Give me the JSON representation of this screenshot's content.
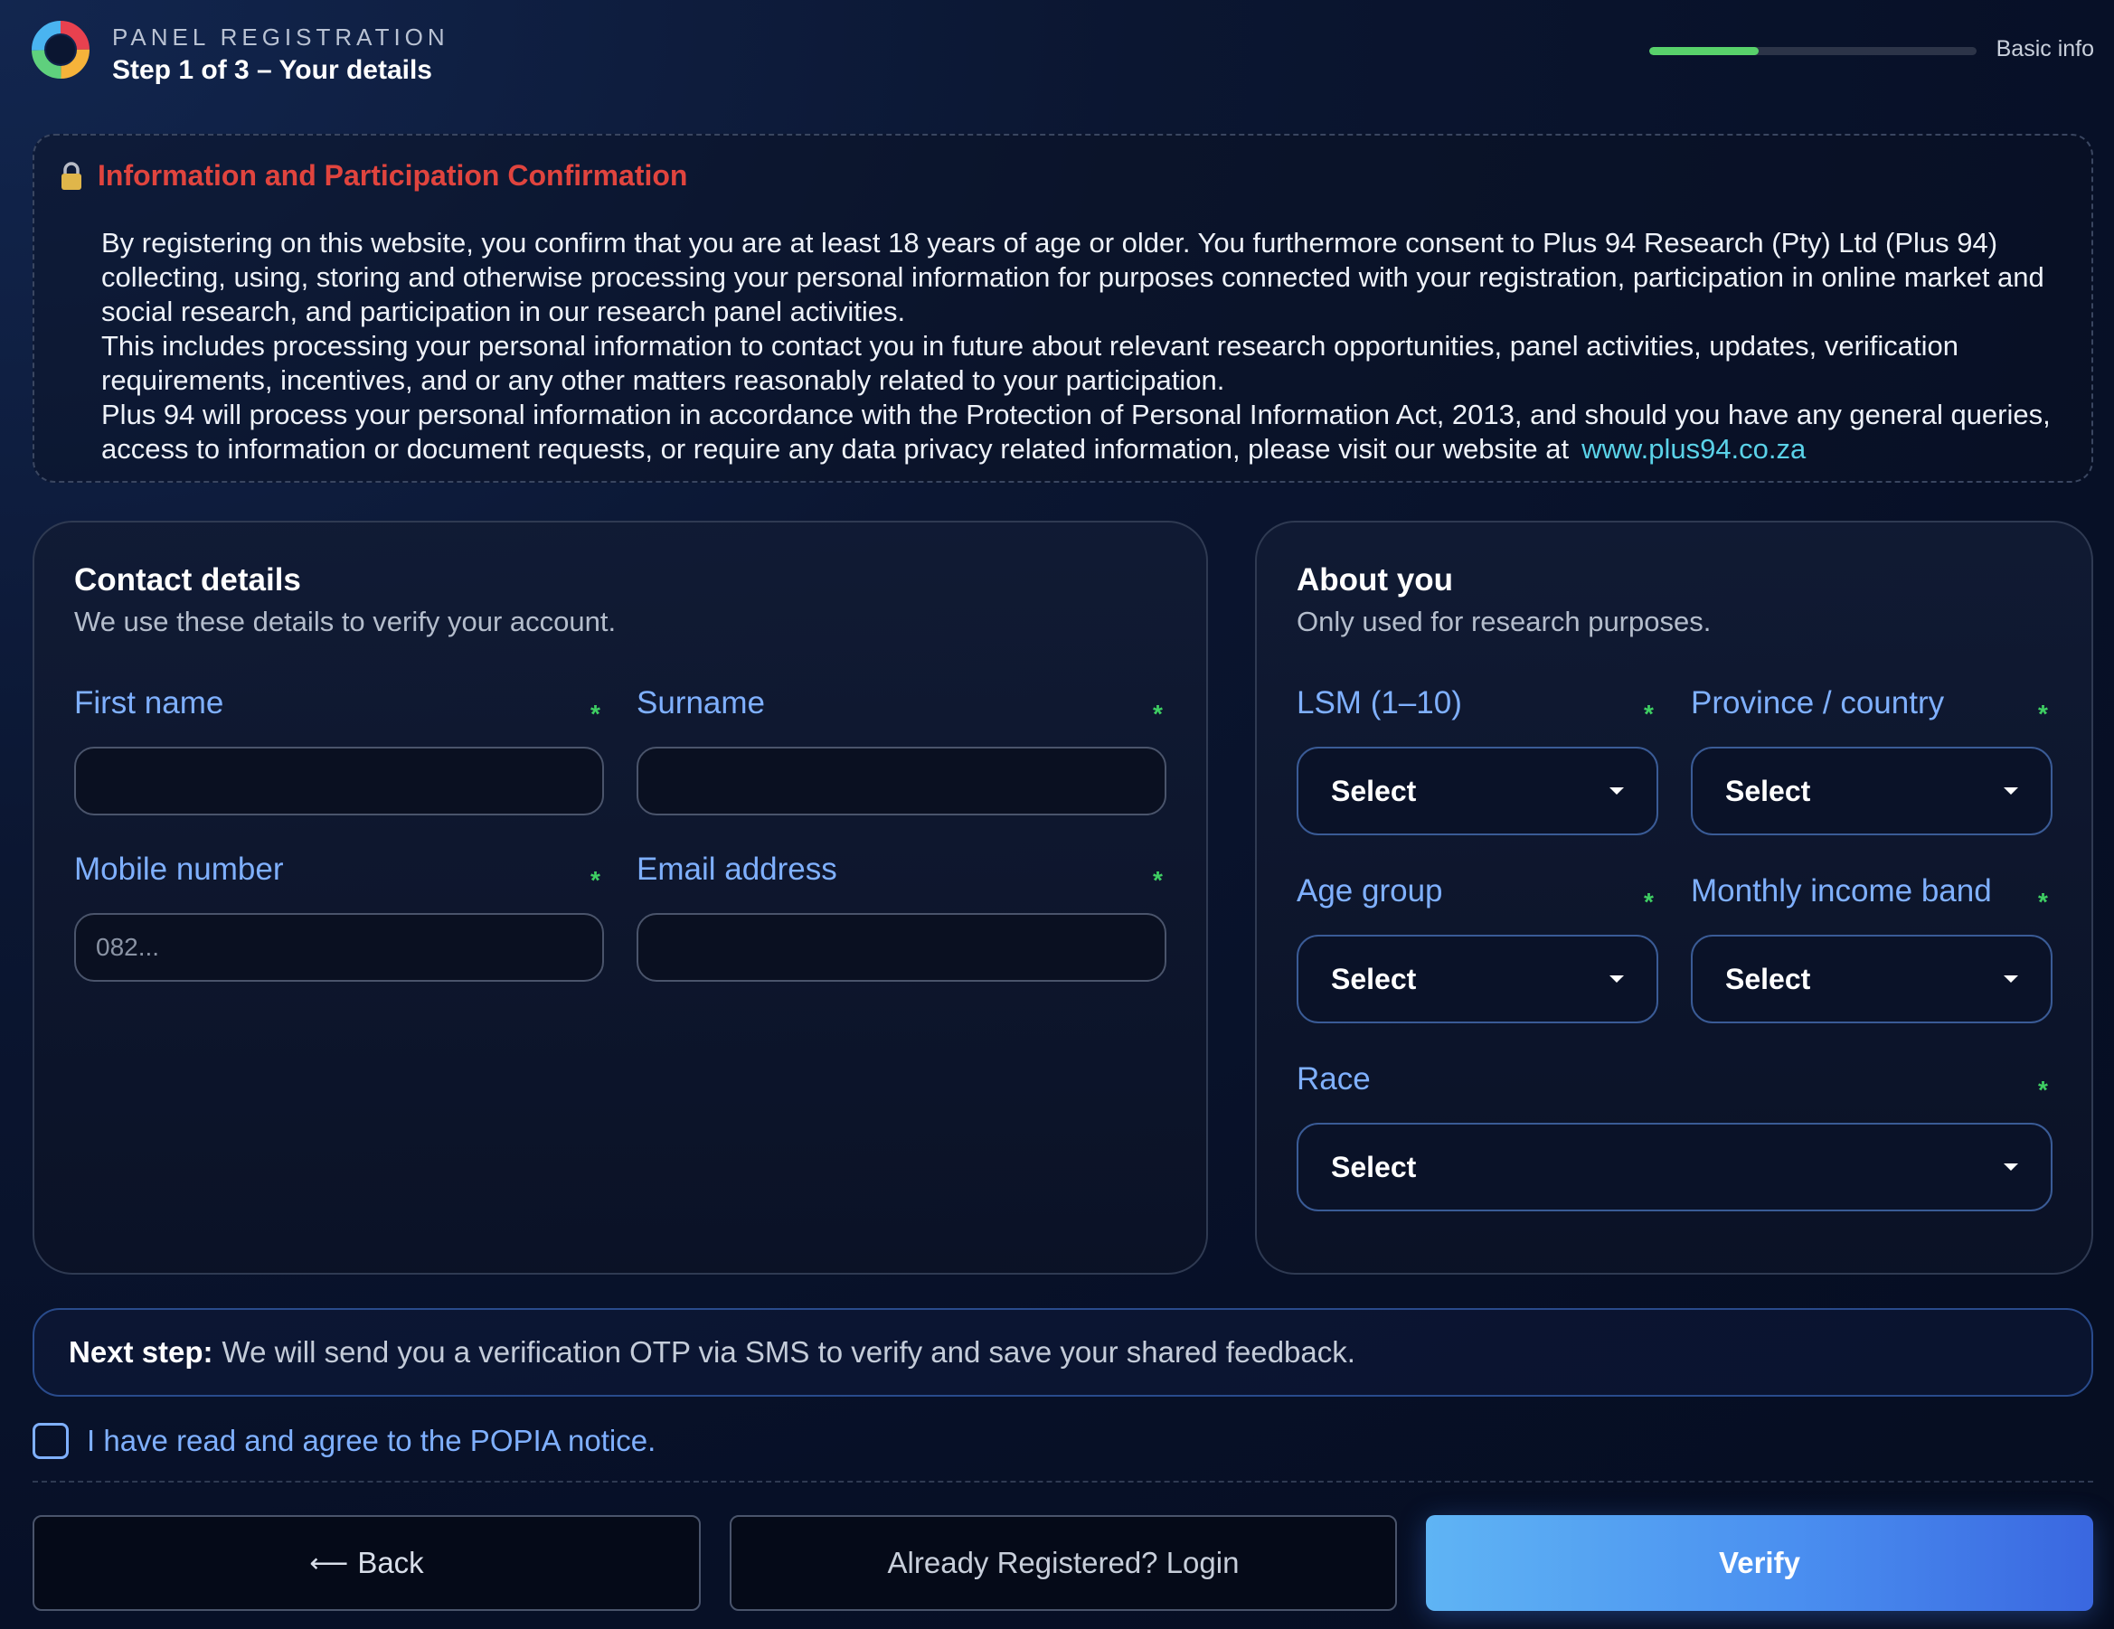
{
  "header": {
    "eyebrow": "PANEL REGISTRATION",
    "step_title": "Step 1 of 3 – Your details",
    "progress_label": "Basic info",
    "progress_fraction": 0.333
  },
  "notice": {
    "title": "Information and Participation Confirmation",
    "paragraphs": [
      "By registering on this website, you confirm that you are at least 18 years of age or older. You furthermore consent to Plus 94 Research (Pty) Ltd (Plus 94) collecting, using, storing and otherwise processing your personal information for purposes connected with your registration, participation in online market and social research, and participation in our research panel activities.",
      "This includes processing your personal information to contact you in future about relevant research opportunities, panel activities, updates, verification requirements, incentives, and or any other matters reasonably related to your participation.",
      "Plus 94 will process your personal information in accordance with the Protection of Personal Information Act, 2013, and should you have any general queries, access to information or document requests, or require any data privacy related information, please visit our website at"
    ],
    "link_text": "www.plus94.co.za"
  },
  "contact": {
    "title": "Contact details",
    "subtitle": "We use these details to verify your account.",
    "first_name_label": "First name",
    "surname_label": "Surname",
    "mobile_label": "Mobile number",
    "mobile_placeholder": "082...",
    "email_label": "Email address",
    "required_mark": "*"
  },
  "about": {
    "title": "About you",
    "subtitle": "Only used for research purposes.",
    "lsm_label": "LSM (1–10)",
    "province_label": "Province / country",
    "age_label": "Age group",
    "income_label": "Monthly income band",
    "race_label": "Race",
    "select_value": "Select",
    "required_mark": "*"
  },
  "next_step": {
    "bold": "Next step:",
    "text": "We will send you a verification OTP via SMS to verify and save your shared feedback."
  },
  "agree_label": "I have read and agree to the POPIA notice.",
  "buttons": {
    "back_arrow": "⟵",
    "back": "Back",
    "login": "Already Registered? Login",
    "verify": "Verify"
  },
  "colors": {
    "accent": "#7fb0ff",
    "required": "#3fcf63",
    "notice_title": "#e0443e",
    "link": "#5ad2e8",
    "progress": "#58d16b"
  }
}
